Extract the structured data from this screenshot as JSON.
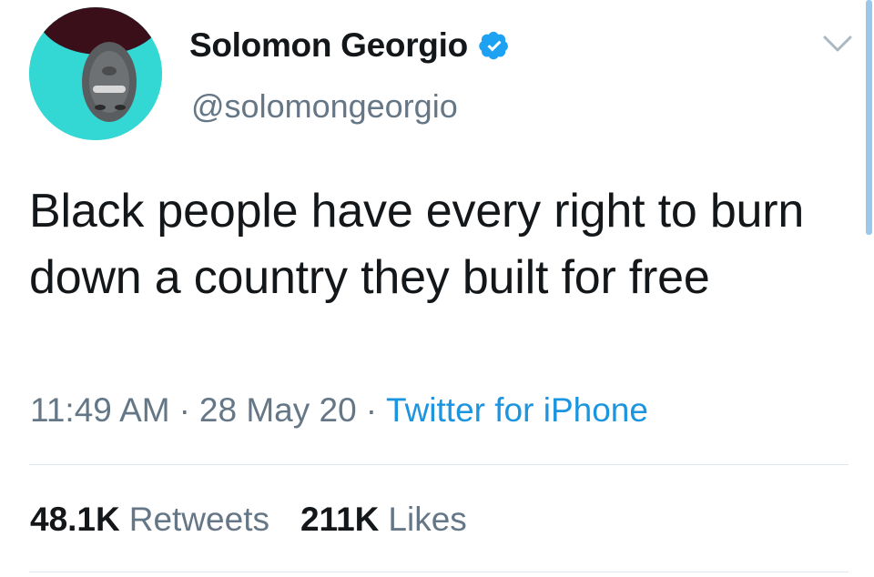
{
  "author": {
    "display_name": "Solomon Georgio",
    "handle": "@solomongeorgio",
    "verified": true,
    "avatar_colors": {
      "background": "#33d7d3",
      "hair": "#3a0f19",
      "skin": "#5a5d5f"
    }
  },
  "tweet": {
    "text": "Black people have every right to burn down a country they built for free"
  },
  "meta": {
    "time": "11:49 AM",
    "separator": "·",
    "date": "28 May 20",
    "source": "Twitter for iPhone"
  },
  "stats": [
    {
      "count": "48.1K",
      "label": "Retweets"
    },
    {
      "count": "211K",
      "label": "Likes"
    }
  ],
  "icons": {
    "verified": "verified-badge-icon",
    "caret": "chevron-down-icon"
  },
  "colors": {
    "primary_text": "#14171a",
    "secondary_text": "#657786",
    "link": "#1b95e0",
    "verified": "#1da1f2",
    "divider": "#e1e8ed"
  }
}
